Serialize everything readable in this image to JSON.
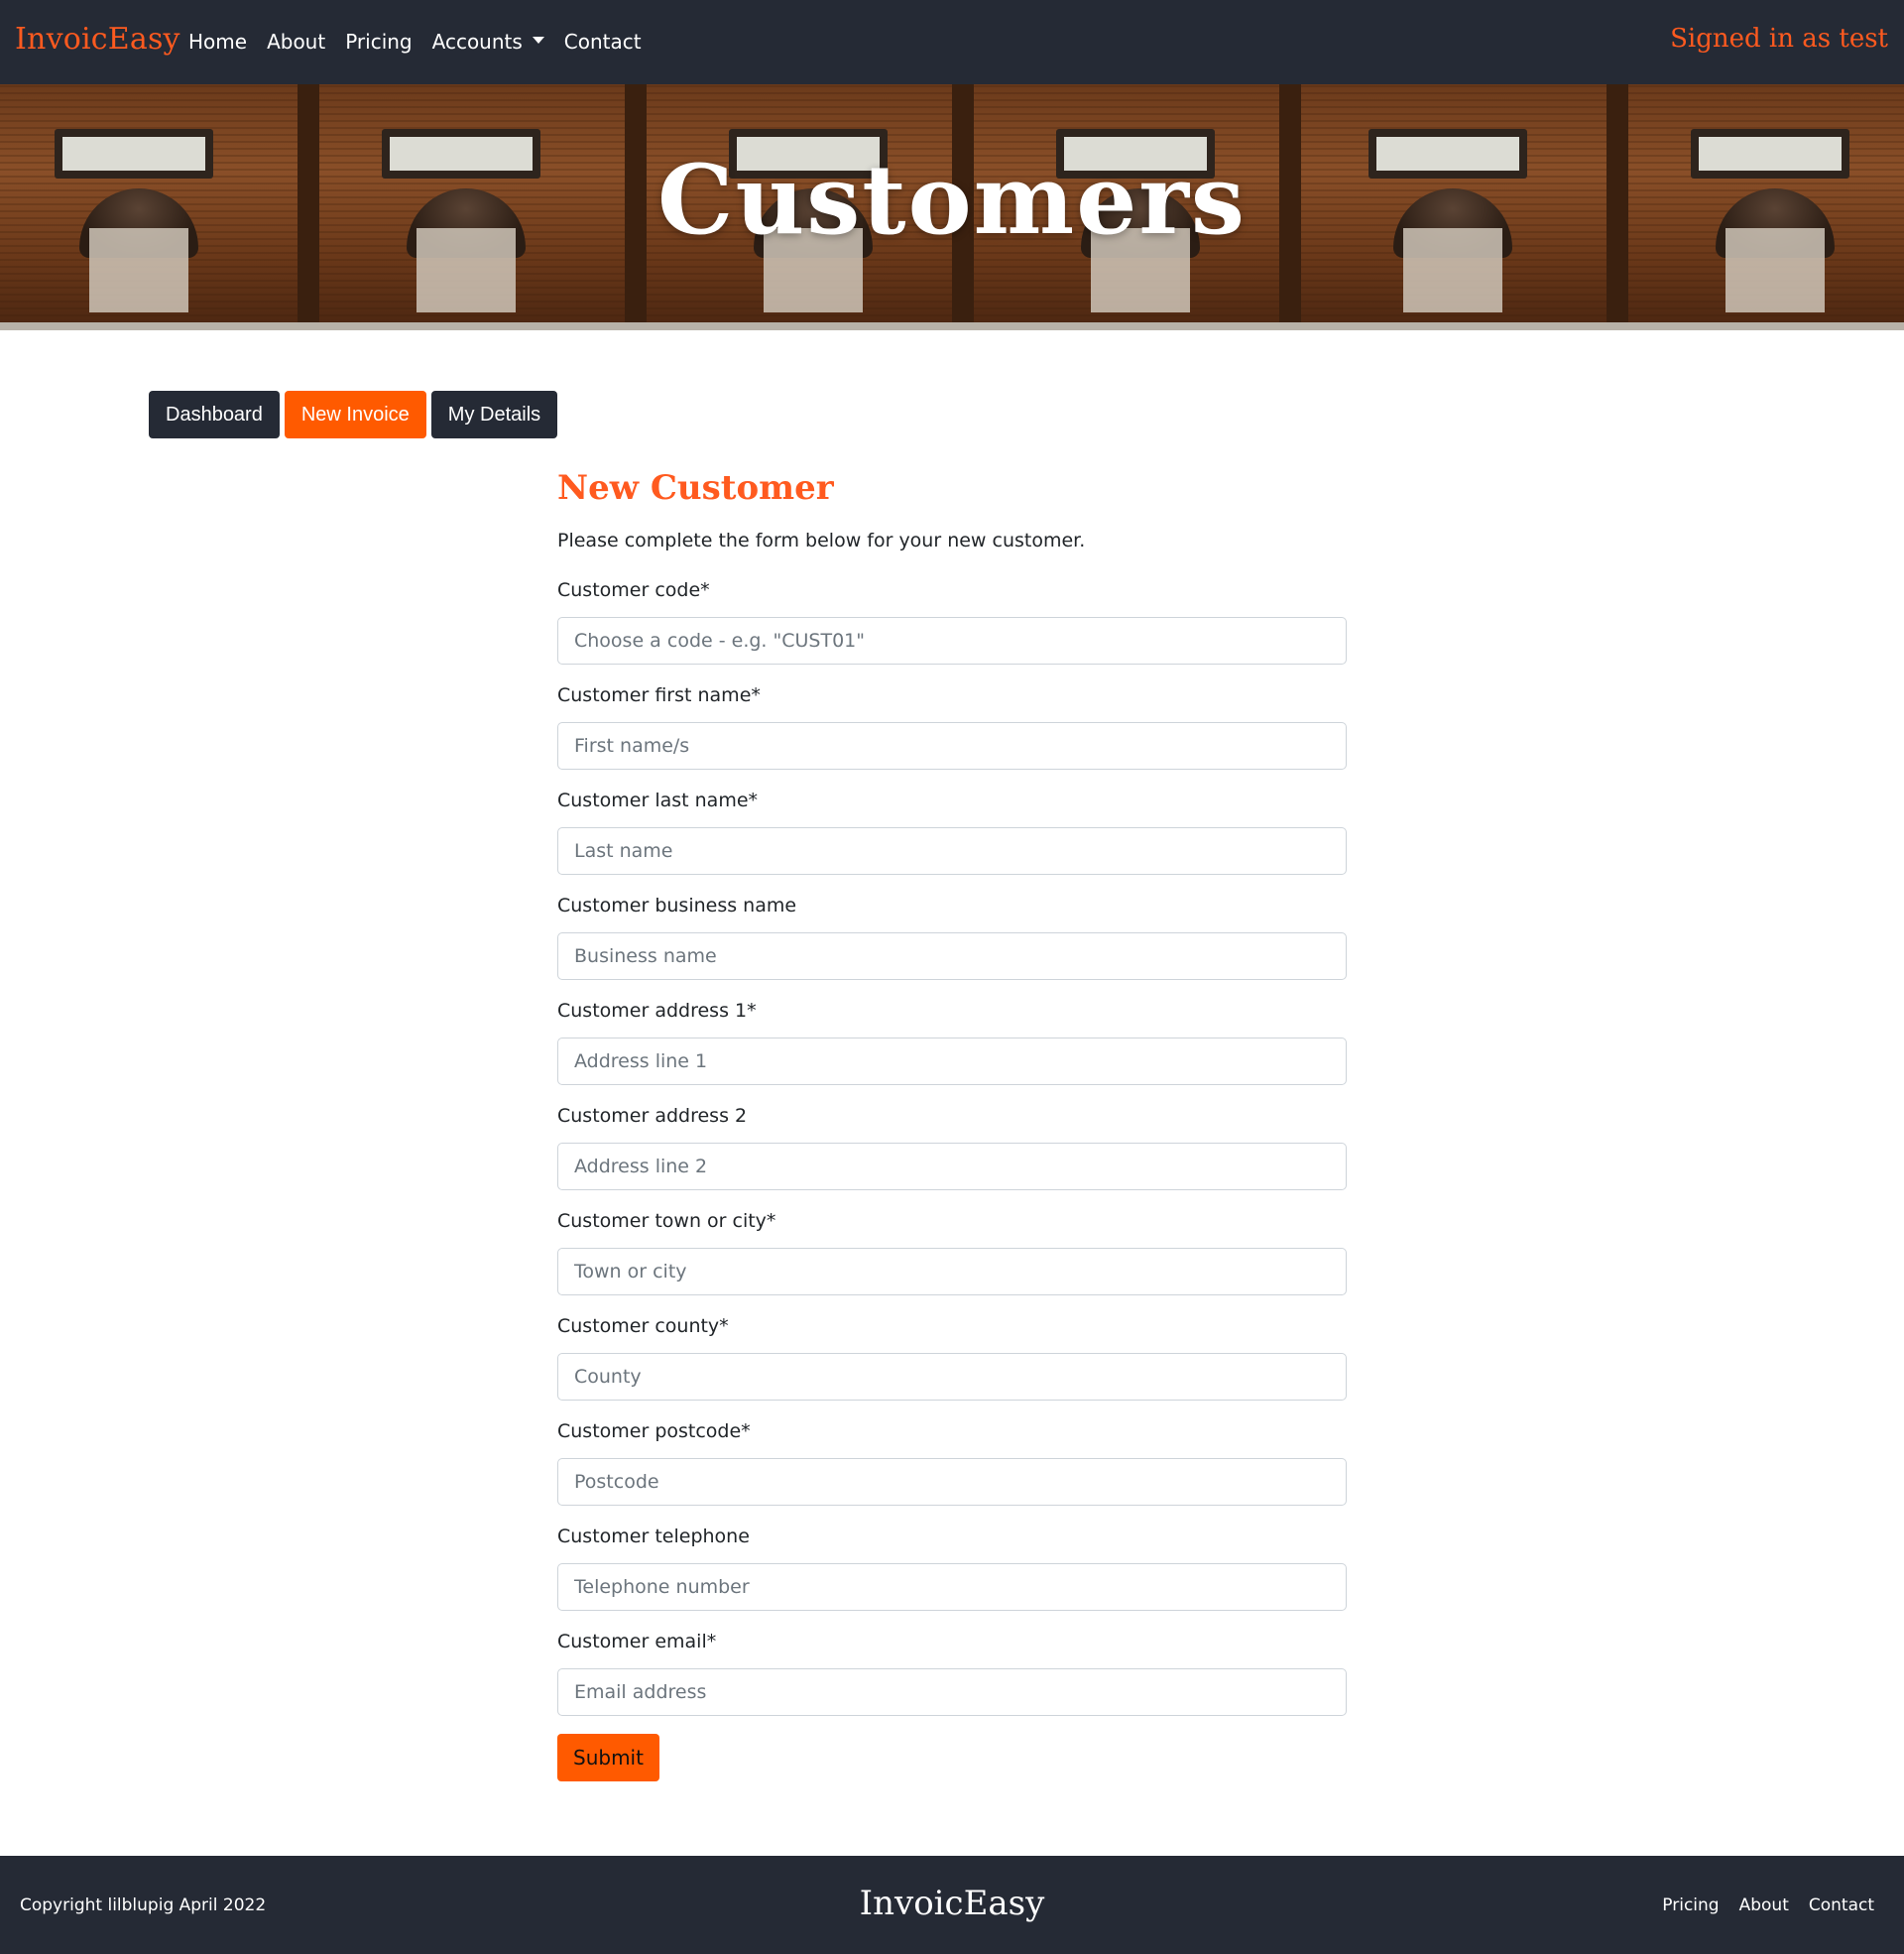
{
  "navbar": {
    "brand": "InvoicEasy",
    "links": [
      {
        "label": "Home"
      },
      {
        "label": "About"
      },
      {
        "label": "Pricing"
      },
      {
        "label": "Accounts"
      },
      {
        "label": "Contact"
      }
    ],
    "signed_in": "Signed in as test"
  },
  "hero": {
    "title": "Customers"
  },
  "tabs": [
    {
      "label": "Dashboard",
      "style": "dark"
    },
    {
      "label": "New Invoice",
      "style": "orange"
    },
    {
      "label": "My Details",
      "style": "dark"
    }
  ],
  "form": {
    "title": "New Customer",
    "intro": "Please complete the form below for your new customer.",
    "fields": [
      {
        "label": "Customer code*",
        "placeholder": "Choose a code - e.g. \"CUST01\"",
        "value": ""
      },
      {
        "label": "Customer first name*",
        "placeholder": "First name/s",
        "value": ""
      },
      {
        "label": "Customer last name*",
        "placeholder": "Last name",
        "value": ""
      },
      {
        "label": "Customer business name",
        "placeholder": "Business name",
        "value": ""
      },
      {
        "label": "Customer address 1*",
        "placeholder": "Address line 1",
        "value": ""
      },
      {
        "label": "Customer address 2",
        "placeholder": "Address line 2",
        "value": ""
      },
      {
        "label": "Customer town or city*",
        "placeholder": "Town or city",
        "value": ""
      },
      {
        "label": "Customer county*",
        "placeholder": "County",
        "value": ""
      },
      {
        "label": "Customer postcode*",
        "placeholder": "Postcode",
        "value": ""
      },
      {
        "label": "Customer telephone",
        "placeholder": "Telephone number",
        "value": ""
      },
      {
        "label": "Customer email*",
        "placeholder": "Email address",
        "value": ""
      }
    ],
    "submit_label": "Submit"
  },
  "footer": {
    "copyright": "Copyright lilblupig April 2022",
    "brand": "InvoicEasy",
    "links": [
      {
        "label": "Pricing"
      },
      {
        "label": "About"
      },
      {
        "label": "Contact"
      }
    ]
  },
  "colors": {
    "accent": "#ff5a1f",
    "dark": "#252a35"
  },
  "icons": {
    "accounts_dropdown": "caret-down-icon"
  }
}
